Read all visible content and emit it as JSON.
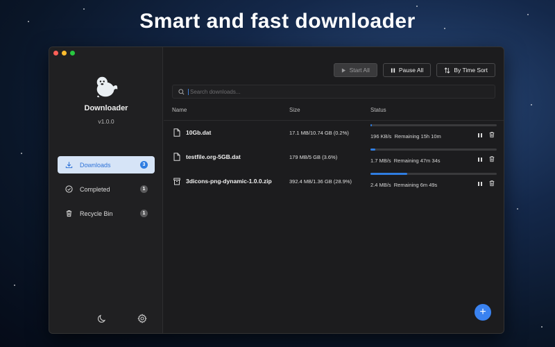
{
  "headline": "Smart and fast downloader",
  "colors": {
    "accent": "#2f7de1",
    "traffic_red": "#ff5f57",
    "traffic_yellow": "#febc2e",
    "traffic_green": "#28c840"
  },
  "sidebar": {
    "app_name": "Downloader",
    "version": "v1.0.0",
    "items": [
      {
        "label": "Downloads",
        "icon": "download-icon",
        "badge": "3",
        "active": true
      },
      {
        "label": "Completed",
        "icon": "check-circle-icon",
        "badge": "1",
        "active": false
      },
      {
        "label": "Recycle Bin",
        "icon": "trash-icon",
        "badge": "1",
        "active": false
      }
    ],
    "bottom_icons": [
      "moon-icon",
      "gear-icon"
    ]
  },
  "toolbar": {
    "start_all": "Start All",
    "pause_all": "Pause All",
    "sort": "By Time Sort"
  },
  "search": {
    "placeholder": "Search downloads..."
  },
  "table": {
    "columns": [
      "Name",
      "Size",
      "Status"
    ],
    "rows": [
      {
        "icon": "file-icon",
        "name": "10Gb.dat",
        "size": "17.1 MB/10.74 GB (0.2%)",
        "progress": 0.2,
        "speed": "196 KB/s",
        "remaining": "Remaining 15h 10m"
      },
      {
        "icon": "file-icon",
        "name": "testfile.org-5GB.dat",
        "size": "179 MB/5 GB (3.6%)",
        "progress": 3.6,
        "speed": "1.7 MB/s",
        "remaining": "Remaining 47m 34s"
      },
      {
        "icon": "archive-icon",
        "name": "3dicons-png-dynamic-1.0.0.zip",
        "size": "392.4 MB/1.36 GB (28.9%)",
        "progress": 28.9,
        "speed": "2.4 MB/s",
        "remaining": "Remaining 6m 49s"
      }
    ]
  },
  "fab": {
    "label": "+"
  }
}
